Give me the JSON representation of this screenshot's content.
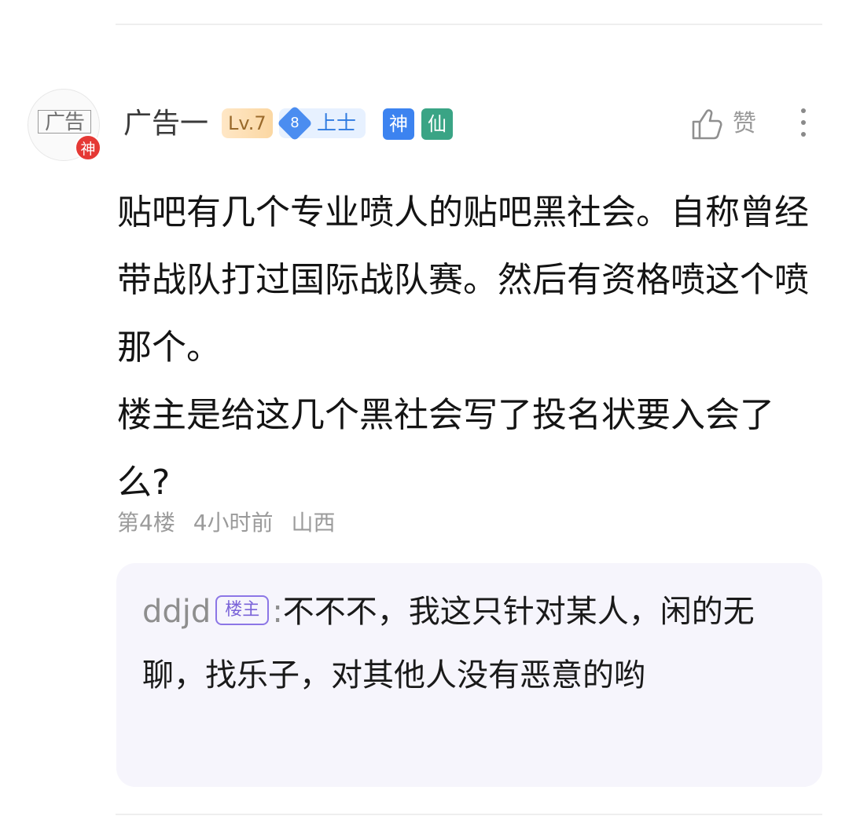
{
  "post": {
    "author": {
      "avatar_text": "广告",
      "avatar_badge": "神",
      "name": "广告一",
      "level": "Lv.7",
      "rank_number": "8",
      "rank_title": "上士",
      "tags": [
        "神",
        "仙"
      ]
    },
    "like_label": "赞",
    "content": [
      "贴吧有几个专业喷人的贴吧黑社会。自称曾经带战队打过国际战队赛。然后有资格喷这个喷那个。",
      "楼主是给这几个黑社会写了投名状要入会了么?"
    ],
    "meta": {
      "floor": "第4楼",
      "time": "4小时前",
      "location": "山西"
    },
    "reply": {
      "user": "ddjd",
      "badge": "楼主",
      "separator": ":",
      "text": "不不不，我这只针对某人，闲的无聊，找乐子，对其他人没有恶意的哟"
    }
  },
  "icons": {
    "like": "thumbs-up-icon",
    "more": "more-vertical-icon"
  },
  "colors": {
    "level_text": "#9a6a2b",
    "rank_blue": "#4b8df0",
    "tag_shen": "#3c83f0",
    "tag_xian": "#3aa485",
    "reply_bg": "#f6f5fc",
    "op_badge": "#7a63d8"
  }
}
